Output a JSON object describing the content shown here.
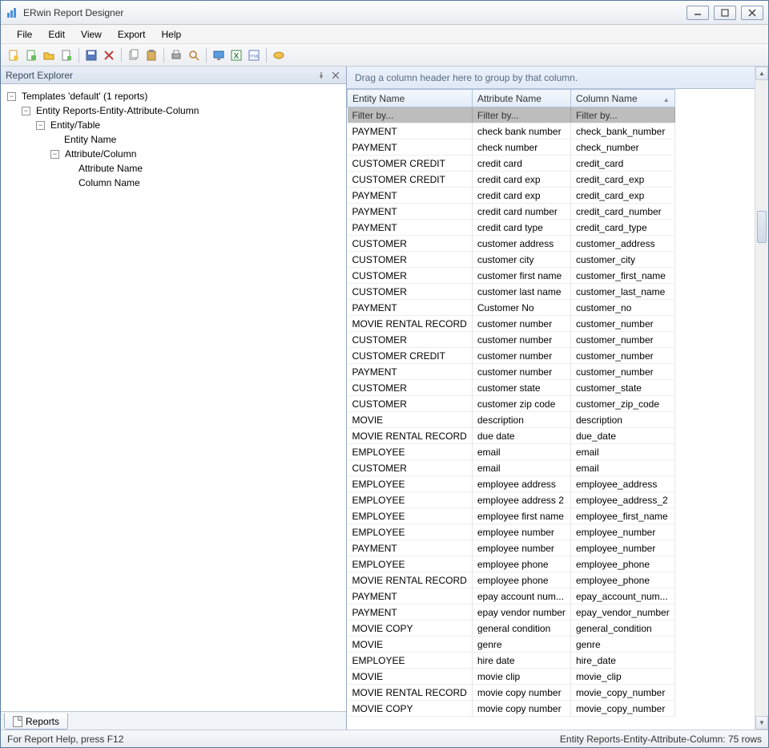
{
  "window": {
    "title": "ERwin Report Designer"
  },
  "menu": {
    "items": [
      "File",
      "Edit",
      "View",
      "Export",
      "Help"
    ]
  },
  "toolbar_icons": [
    "new-report-icon",
    "open-icon",
    "save-icon",
    "save-as-icon",
    "export-icon",
    "cut-icon",
    "copy-icon",
    "paste-icon",
    "paste2-icon",
    "print-icon",
    "preview-icon",
    "monitor-icon",
    "excel-icon",
    "html-icon",
    "help-icon"
  ],
  "explorer": {
    "title": "Report Explorer",
    "tab": "Reports",
    "root": "Templates 'default' (1 reports)",
    "node1": "Entity Reports-Entity-Attribute-Column",
    "node2": "Entity/Table",
    "leaf1": "Entity Name",
    "node3": "Attribute/Column",
    "leaf2": "Attribute Name",
    "leaf3": "Column Name"
  },
  "grid": {
    "group_hint": "Drag a column header here to group by that column.",
    "columns": [
      "Entity Name",
      "Attribute Name",
      "Column Name"
    ],
    "filter_placeholder": "Filter by...",
    "rows": [
      [
        "PAYMENT",
        "check bank number",
        "check_bank_number"
      ],
      [
        "PAYMENT",
        "check number",
        "check_number"
      ],
      [
        "CUSTOMER CREDIT",
        "credit card",
        "credit_card"
      ],
      [
        "CUSTOMER CREDIT",
        "credit card exp",
        "credit_card_exp"
      ],
      [
        "PAYMENT",
        "credit card exp",
        "credit_card_exp"
      ],
      [
        "PAYMENT",
        "credit card number",
        "credit_card_number"
      ],
      [
        "PAYMENT",
        "credit card type",
        "credit_card_type"
      ],
      [
        "CUSTOMER",
        "customer address",
        "customer_address"
      ],
      [
        "CUSTOMER",
        "customer city",
        "customer_city"
      ],
      [
        "CUSTOMER",
        "customer first name",
        "customer_first_name"
      ],
      [
        "CUSTOMER",
        "customer last name",
        "customer_last_name"
      ],
      [
        "PAYMENT",
        "Customer No",
        "customer_no"
      ],
      [
        "MOVIE RENTAL RECORD",
        "customer number",
        "customer_number"
      ],
      [
        "CUSTOMER",
        "customer number",
        "customer_number"
      ],
      [
        "CUSTOMER CREDIT",
        "customer number",
        "customer_number"
      ],
      [
        "PAYMENT",
        "customer number",
        "customer_number"
      ],
      [
        "CUSTOMER",
        "customer state",
        "customer_state"
      ],
      [
        "CUSTOMER",
        "customer zip code",
        "customer_zip_code"
      ],
      [
        "MOVIE",
        "description",
        "description"
      ],
      [
        "MOVIE RENTAL RECORD",
        "due date",
        "due_date"
      ],
      [
        "EMPLOYEE",
        "email",
        "email"
      ],
      [
        "CUSTOMER",
        "email",
        "email"
      ],
      [
        "EMPLOYEE",
        "employee address",
        "employee_address"
      ],
      [
        "EMPLOYEE",
        "employee address 2",
        "employee_address_2"
      ],
      [
        "EMPLOYEE",
        "employee first name",
        "employee_first_name"
      ],
      [
        "EMPLOYEE",
        "employee number",
        "employee_number"
      ],
      [
        "PAYMENT",
        "employee number",
        "employee_number"
      ],
      [
        "EMPLOYEE",
        "employee phone",
        "employee_phone"
      ],
      [
        "MOVIE RENTAL RECORD",
        "employee phone",
        "employee_phone"
      ],
      [
        "PAYMENT",
        "epay account num...",
        "epay_account_num..."
      ],
      [
        "PAYMENT",
        "epay vendor number",
        "epay_vendor_number"
      ],
      [
        "MOVIE COPY",
        "general condition",
        "general_condition"
      ],
      [
        "MOVIE",
        "genre",
        "genre"
      ],
      [
        "EMPLOYEE",
        "hire date",
        "hire_date"
      ],
      [
        "MOVIE",
        "movie clip",
        "movie_clip"
      ],
      [
        "MOVIE RENTAL RECORD",
        "movie copy number",
        "movie_copy_number"
      ],
      [
        "MOVIE COPY",
        "movie copy number",
        "movie_copy_number"
      ]
    ]
  },
  "status": {
    "left": "For Report Help, press F12",
    "right": "Entity Reports-Entity-Attribute-Column: 75 rows"
  }
}
